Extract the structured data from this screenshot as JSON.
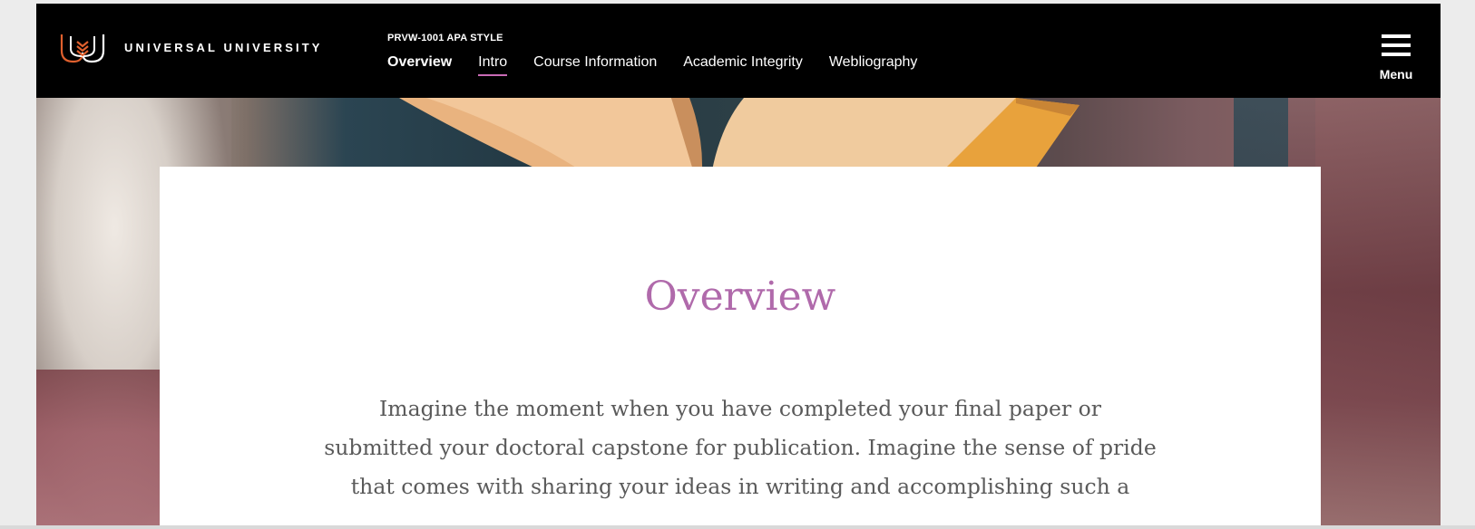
{
  "header": {
    "brand_name": "UNIVERSAL UNIVERSITY",
    "course_code": "PRVW-1001 APA STYLE",
    "nav": [
      {
        "label": "Overview"
      },
      {
        "label": "Intro"
      },
      {
        "label": "Course Information"
      },
      {
        "label": "Academic Integrity"
      },
      {
        "label": "Webliography"
      }
    ],
    "menu_label": "Menu",
    "icons": {
      "logo": "university-shield-logo-icon",
      "menu": "hamburger-menu-icon"
    }
  },
  "content": {
    "title": "Overview",
    "body_lines": [
      "Imagine the moment when you have completed your final paper or",
      "submitted your doctoral capstone for publication. Imagine the sense of pride",
      "that comes with sharing your ideas in writing and accomplishing such a"
    ]
  },
  "colors": {
    "header_background": "#000000",
    "accent": "#b06aab",
    "active_underline": "#c96bb6",
    "logo_orange": "#e0602e",
    "body_text": "#5a5a5a"
  }
}
